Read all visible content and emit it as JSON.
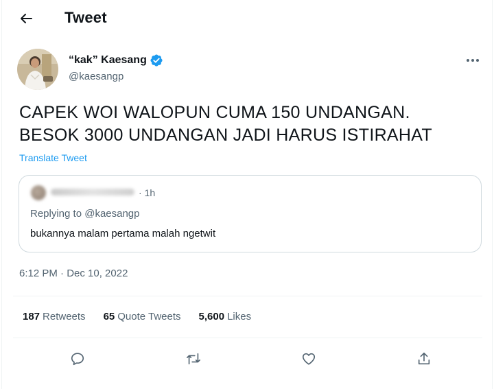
{
  "header": {
    "title": "Tweet",
    "back_icon": "arrow-left-icon"
  },
  "author": {
    "name": "“kak” Kaesang",
    "handle": "@kaesangp",
    "verified_icon": "verified-badge-icon",
    "verified_color": "#1d9bf0"
  },
  "tweet": {
    "text": "CAPEK WOI WALOPUN CUMA 150 UNDANGAN.\nBESOK 3000 UNDANGAN JADI HARUS ISTIRAHAT",
    "translate_label": "Translate Tweet",
    "timestamp": "6:12 PM · Dec 10, 2022"
  },
  "quoted": {
    "time": "· 1h",
    "replying_to": "Replying to @kaesangp",
    "text": "bukannya malam pertama malah ngetwit"
  },
  "stats": {
    "retweets_count": "187",
    "retweets_label": "Retweets",
    "quotes_count": "65",
    "quotes_label": "Quote Tweets",
    "likes_count": "5,600",
    "likes_label": "Likes"
  },
  "actions": [
    "reply-icon",
    "retweet-icon",
    "like-icon",
    "share-icon"
  ],
  "colors": {
    "accent": "#1d9bf0",
    "secondary_text": "#536471",
    "border": "#cfd9de"
  }
}
